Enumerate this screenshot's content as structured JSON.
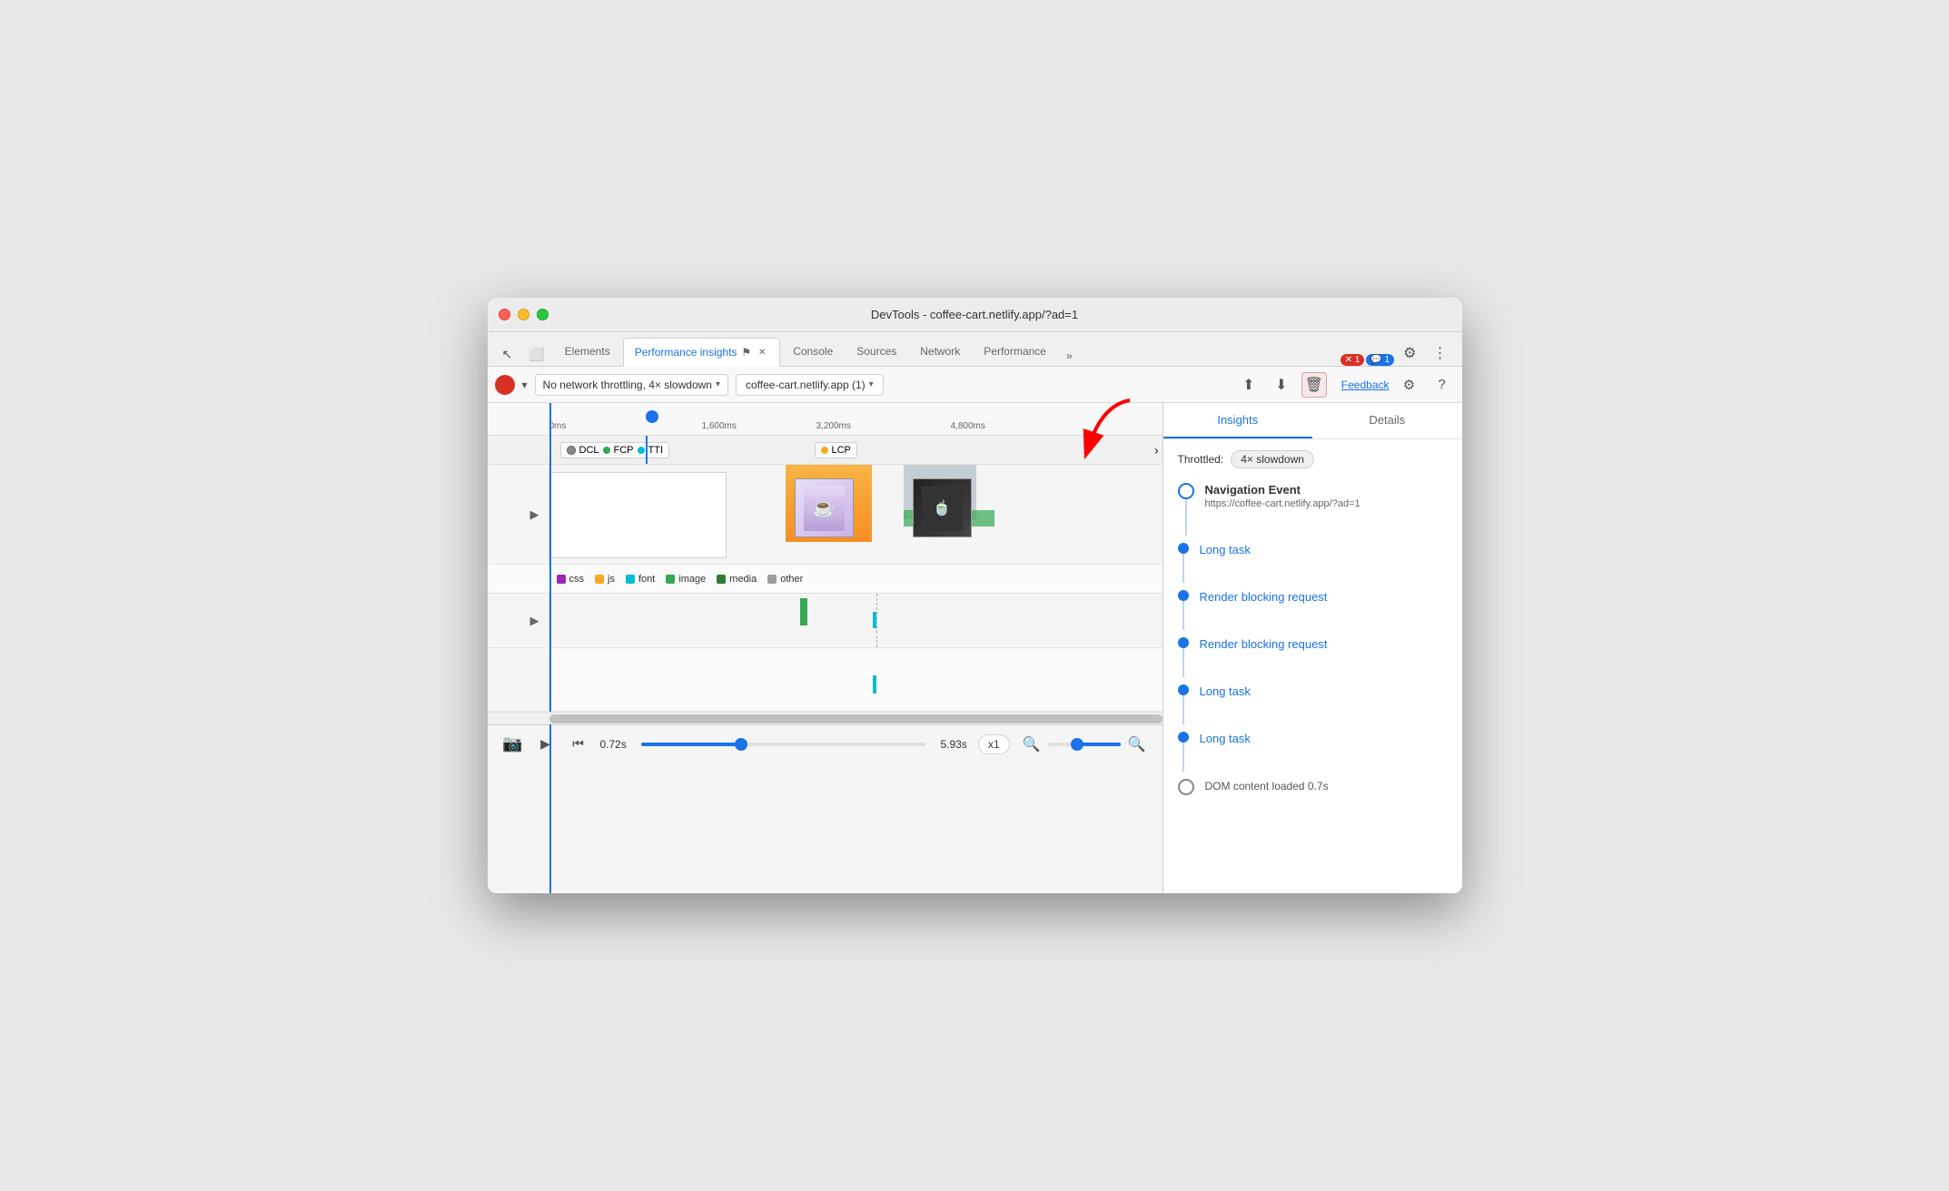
{
  "window": {
    "title": "DevTools - coffee-cart.netlify.app/?ad=1"
  },
  "tabs": [
    {
      "label": "Elements",
      "active": false,
      "closable": false
    },
    {
      "label": "Performance insights",
      "active": true,
      "closable": true
    },
    {
      "label": "Console",
      "active": false,
      "closable": false
    },
    {
      "label": "Sources",
      "active": false,
      "closable": false
    },
    {
      "label": "Network",
      "active": false,
      "closable": false
    },
    {
      "label": "Performance",
      "active": false,
      "closable": false
    }
  ],
  "toolbar": {
    "throttling": "No network throttling, 4× slowdown",
    "url": "coffee-cart.netlify.app (1)",
    "feedback_label": "Feedback"
  },
  "timeline": {
    "markers": [
      "0ms",
      "1,600ms",
      "3,200ms",
      "4,800ms"
    ],
    "event_markers": [
      "DCL",
      "FCP",
      "TTI",
      "LCP"
    ],
    "time_start": "0.72s",
    "time_end": "5.93s",
    "speed": "x1"
  },
  "legend": {
    "items": [
      {
        "label": "css",
        "color": "#9c27b0"
      },
      {
        "label": "js",
        "color": "#f9a825"
      },
      {
        "label": "font",
        "color": "#00bcd4"
      },
      {
        "label": "image",
        "color": "#34a853"
      },
      {
        "label": "media",
        "color": "#2e7d32"
      },
      {
        "label": "other",
        "color": "#9e9e9e"
      }
    ]
  },
  "right_panel": {
    "tabs": [
      "Insights",
      "Details"
    ],
    "active_tab": "Insights",
    "throttled_label": "Throttled:",
    "throttled_value": "4× slowdown",
    "insights": [
      {
        "type": "nav_event",
        "title": "Navigation Event",
        "url": "https://coffee-cart.netlify.app/?ad=1"
      },
      {
        "type": "link",
        "label": "Long task"
      },
      {
        "type": "link",
        "label": "Render blocking request"
      },
      {
        "type": "link",
        "label": "Render blocking request"
      },
      {
        "type": "link",
        "label": "Long task"
      },
      {
        "type": "link",
        "label": "Long task"
      },
      {
        "type": "dom",
        "label": "DOM content loaded 0.7s"
      }
    ]
  },
  "bottom_controls": {
    "time_start": "0.72s",
    "time_end": "5.93s",
    "speed": "x1"
  }
}
